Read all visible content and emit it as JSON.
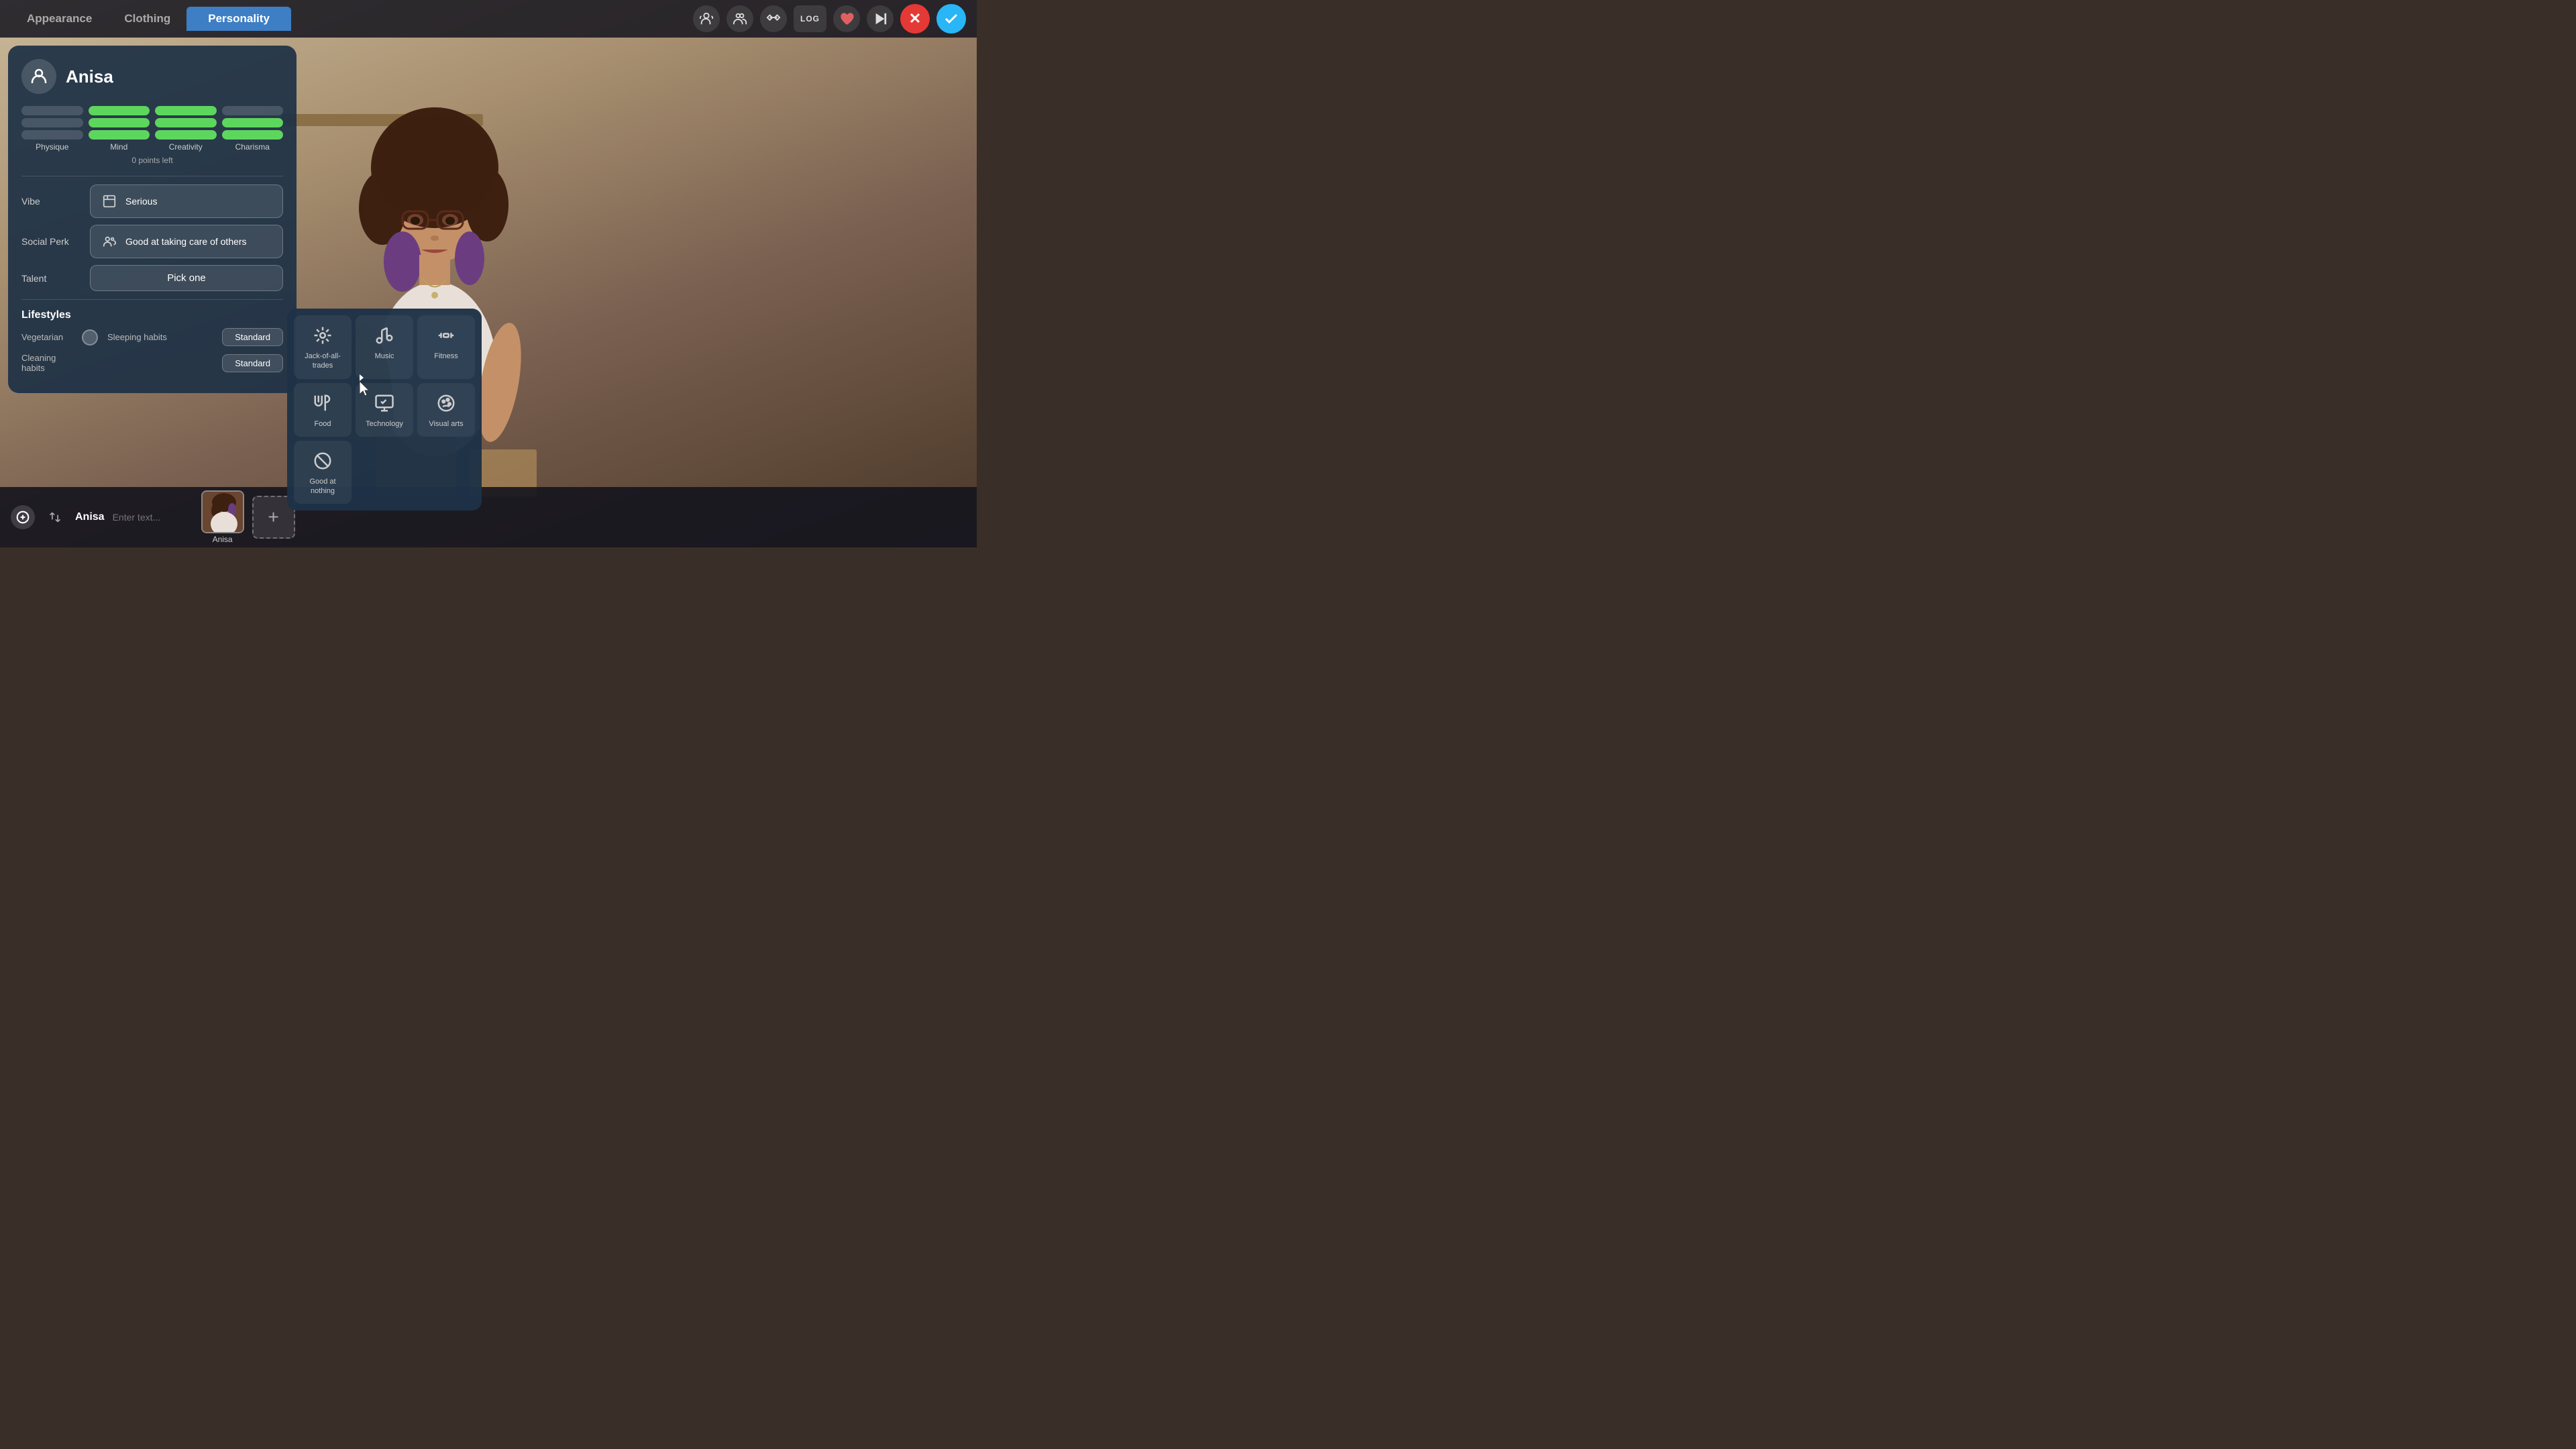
{
  "nav": {
    "tabs": [
      {
        "id": "appearance",
        "label": "Appearance",
        "active": false
      },
      {
        "id": "clothing",
        "label": "Clothing",
        "active": false
      },
      {
        "id": "personality",
        "label": "Personality",
        "active": true
      }
    ],
    "icons": [
      {
        "id": "people-icon",
        "symbol": "👥"
      },
      {
        "id": "group-icon",
        "symbol": "👨‍👩‍👧"
      },
      {
        "id": "hand-icon",
        "symbol": "🤝"
      },
      {
        "id": "log-icon",
        "label": "LOG"
      },
      {
        "id": "heart-icon",
        "symbol": "❤"
      },
      {
        "id": "play-icon",
        "symbol": "▶"
      }
    ],
    "cancel_label": "✕",
    "confirm_label": "✓"
  },
  "character": {
    "name": "Anisa",
    "avatar_icon": "👤",
    "stats": [
      {
        "label": "Physique",
        "bars": [
          {
            "fill": 0
          },
          {
            "fill": 0
          },
          {
            "fill": 0
          }
        ]
      },
      {
        "label": "Mind",
        "bars": [
          {
            "fill": 100
          },
          {
            "fill": 100
          },
          {
            "fill": 100
          }
        ]
      },
      {
        "label": "Creativity",
        "bars": [
          {
            "fill": 100
          },
          {
            "fill": 100
          },
          {
            "fill": 100
          }
        ]
      },
      {
        "label": "Charisma",
        "bars": [
          {
            "fill": 0
          },
          {
            "fill": 100
          },
          {
            "fill": 100
          }
        ]
      }
    ],
    "points_left": "0 points left"
  },
  "traits": {
    "vibe": {
      "label": "Vibe",
      "value": "Serious",
      "icon": "📖"
    },
    "social_perk": {
      "label": "Social Perk",
      "value": "Good at taking care of others",
      "icon": "👥"
    },
    "talent": {
      "label": "Talent",
      "value": "Pick one"
    }
  },
  "lifestyles": {
    "title": "Lifestyles",
    "items": [
      {
        "label": "Vegetarian",
        "sub_label": "",
        "has_toggle": true,
        "value": null
      },
      {
        "label": "Cleaning habits",
        "sub_label": "Sleeping habits",
        "has_toggle": false,
        "value": "Standard"
      },
      {
        "label": "Cleaning habits",
        "sub_label": "",
        "has_toggle": false,
        "value": "Standard"
      }
    ],
    "sleeping_habits_label": "Sleeping habits",
    "sleeping_value": "Standard",
    "cleaning_label": "Cleaning habits",
    "cleaning_value": "Standard"
  },
  "talent_dropdown": {
    "items": [
      {
        "id": "jack-of-all-trades",
        "label": "Jack-of-all-trades",
        "icon": "✦"
      },
      {
        "id": "music",
        "label": "Music",
        "icon": "🎵"
      },
      {
        "id": "fitness",
        "label": "Fitness",
        "icon": "🏋"
      },
      {
        "id": "food",
        "label": "Food",
        "icon": "🍳"
      },
      {
        "id": "technology",
        "label": "Technology",
        "icon": "💻"
      },
      {
        "id": "visual-arts",
        "label": "Visual arts",
        "icon": "🎨"
      },
      {
        "id": "good-at-nothing",
        "label": "Good at nothing",
        "icon": "⊘"
      }
    ]
  },
  "bottom_bar": {
    "char_name": "Anisa",
    "input_placeholder": "Enter text...",
    "add_char_symbol": "+"
  }
}
